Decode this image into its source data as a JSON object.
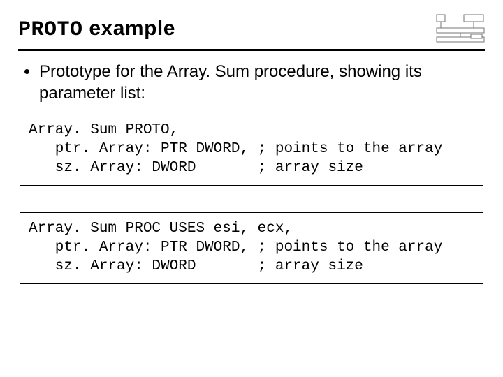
{
  "title_mono": "PROTO",
  "title_rest": " example",
  "bullet": "Prototype for the Array. Sum procedure, showing its parameter list:",
  "codebox1": "Array. Sum PROTO,\n   ptr. Array: PTR DWORD, ; points to the array\n   sz. Array: DWORD       ; array size",
  "codebox2": "Array. Sum PROC USES esi, ecx,\n   ptr. Array: PTR DWORD, ; points to the array\n   sz. Array: DWORD       ; array size"
}
